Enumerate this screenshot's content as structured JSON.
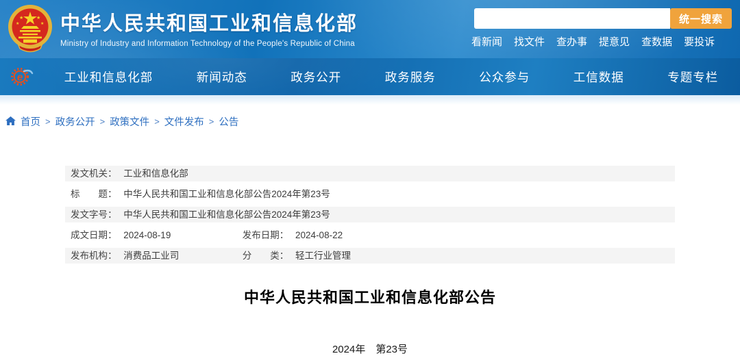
{
  "colors": {
    "header_blue": "#1172ba",
    "nav_blue": "#0d63a9",
    "search_button_orange": "#f0a33c",
    "breadcrumb_blue": "#2e6fc0",
    "meta_row_gray": "#f4f4f4",
    "emblem_red": "#d5281e",
    "emblem_gold": "#e3b33a"
  },
  "header": {
    "site_title": "中华人民共和国工业和信息化部",
    "site_subtitle": "Ministry of Industry and Information Technology of the People's Republic of China",
    "search_button": "统一搜索",
    "quick_links": [
      "看新闻",
      "找文件",
      "查办事",
      "提意见",
      "查数据",
      "要投诉"
    ]
  },
  "nav": {
    "items": [
      "工业和信息化部",
      "新闻动态",
      "政务公开",
      "政务服务",
      "公众参与",
      "工信数据",
      "专题专栏"
    ]
  },
  "breadcrumb": {
    "separator": ">",
    "items": [
      "首页",
      "政务公开",
      "政策文件",
      "文件发布",
      "公告"
    ]
  },
  "doc_meta": {
    "issuing_authority_label": "发文机关：",
    "issuing_authority": "工业和信息化部",
    "title_label": "标　　题：",
    "title": "中华人民共和国工业和信息化部公告2024年第23号",
    "doc_number_label": "发文字号：",
    "doc_number": "中华人民共和国工业和信息化部公告2024年第23号",
    "written_date_label": "成文日期：",
    "written_date": "2024-08-19",
    "publish_date_label": "发布日期：",
    "publish_date": "2024-08-22",
    "publisher_label": "发布机构：",
    "publisher": "消费品工业司",
    "category_label": "分　　类：",
    "category": "轻工行业管理"
  },
  "article": {
    "title": "中华人民共和国工业和信息化部公告",
    "issue_number": "2024年　第23号"
  }
}
